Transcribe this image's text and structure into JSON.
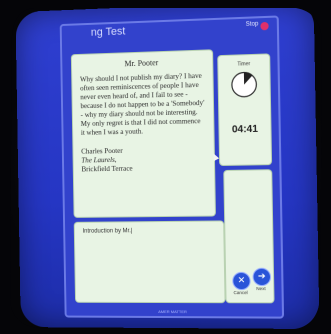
{
  "window": {
    "title": "ng Test",
    "stop_label": "Stop"
  },
  "passage": {
    "title": "Mr. Pooter",
    "body": "Why should I not publish my diary? I have often seen reminiscences of people I have never even heard of, and I fail to see - because I do not happen to be a 'Somebody' - why my diary should not be interesting. My only regret is that I did not commence it when I was a youth.",
    "signature_name": "Charles Pooter",
    "signature_line2": "The Laurels,",
    "signature_line3": "Brickfield Terrace"
  },
  "timer": {
    "label": "Timer",
    "value": "04:41",
    "elapsed_fraction": 0.12
  },
  "answer": {
    "value": "Introduction by Mr.|"
  },
  "navigation": {
    "cancel_label": "Cancel",
    "next_label": "Next"
  },
  "footer": {
    "text": "AMER MATTER"
  },
  "colors": {
    "screen_blue": "#2f3fd0",
    "panel_green": "#e8f4e4",
    "close_pink": "#e0306a"
  },
  "icons": {
    "cancel": "close-x-icon",
    "next": "arrow-right-icon"
  }
}
